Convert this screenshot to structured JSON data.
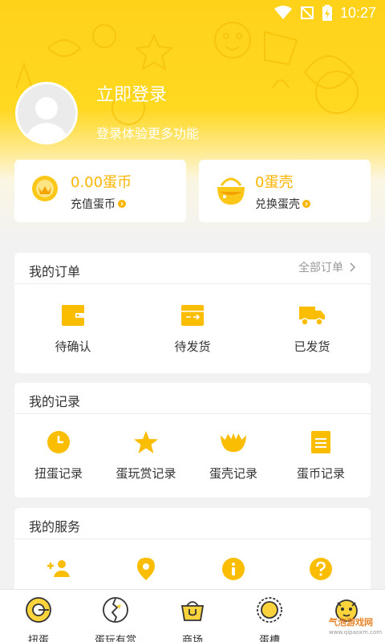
{
  "status_bar": {
    "time": "10:27"
  },
  "profile": {
    "title": "立即登录",
    "subtitle": "登录体验更多功能"
  },
  "coins": {
    "value": "0.00蛋币",
    "label": "充值蛋币"
  },
  "shells": {
    "value": "0蛋壳",
    "label": "兑换蛋壳"
  },
  "orders": {
    "title": "我的订单",
    "all_label": "全部订单",
    "items": [
      {
        "label": "待确认",
        "icon": "wallet-icon"
      },
      {
        "label": "待发货",
        "icon": "package-icon"
      },
      {
        "label": "已发货",
        "icon": "truck-icon"
      }
    ]
  },
  "records": {
    "title": "我的记录",
    "items": [
      {
        "label": "扭蛋记录",
        "icon": "clock-icon"
      },
      {
        "label": "蛋玩赏记录",
        "icon": "star-icon"
      },
      {
        "label": "蛋壳记录",
        "icon": "crown-icon"
      },
      {
        "label": "蛋币记录",
        "icon": "document-icon"
      }
    ]
  },
  "services": {
    "title": "我的服务",
    "items": [
      {
        "icon": "add-person-icon"
      },
      {
        "icon": "location-pin-icon"
      },
      {
        "icon": "info-icon"
      },
      {
        "icon": "help-icon"
      }
    ]
  },
  "tabbar": {
    "items": [
      {
        "label": "扭蛋",
        "icon": "capsule-machine-icon"
      },
      {
        "label": "蛋玩有赏",
        "icon": "cracked-egg-icon"
      },
      {
        "label": "商场",
        "icon": "shopping-basket-icon"
      },
      {
        "label": "蛋槽",
        "icon": "egg-slot-icon"
      },
      {
        "label": "",
        "icon": "mascot-icon"
      }
    ]
  },
  "watermark": {
    "line1": "气泡游戏网",
    "line2": "www.qipaoxm.com"
  },
  "colors": {
    "brand": "#ffd21a",
    "accent": "#fbb400",
    "background": "#f2f2f2"
  }
}
